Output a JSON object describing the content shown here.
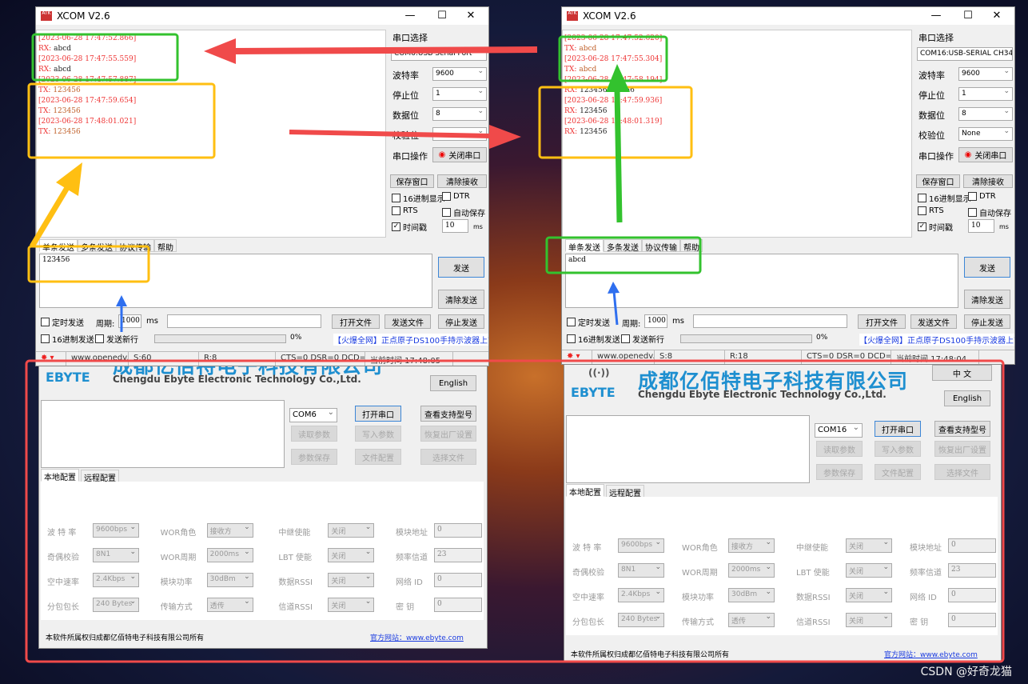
{
  "xcom": [
    {
      "title": "XCOM V2.6",
      "log": [
        {
          "kind": "ts",
          "text": "[2023-06-28 17:47:52.866]"
        },
        {
          "kind": "rx",
          "label": "RX:",
          "text": "abcd"
        },
        {
          "kind": "ts",
          "text": "[2023-06-28 17:47:55.559]"
        },
        {
          "kind": "rx",
          "label": "RX:",
          "text": "abcd"
        },
        {
          "kind": "ts",
          "text": "[2023-06-28 17:47:57.887]"
        },
        {
          "kind": "tx",
          "label": "TX:",
          "text": "123456"
        },
        {
          "kind": "ts",
          "text": "[2023-06-28 17:47:59.654]"
        },
        {
          "kind": "tx",
          "label": "TX:",
          "text": "123456"
        },
        {
          "kind": "ts",
          "text": "[2023-06-28 17:48:01.021]"
        },
        {
          "kind": "tx",
          "label": "TX:",
          "text": "123456"
        }
      ],
      "port_label": "串口选择",
      "port": "COM6:USB Serial Port",
      "baud_label": "波特率",
      "baud": "9600",
      "stop_label": "停止位",
      "stop": "1",
      "data_label": "数据位",
      "databits": "8",
      "parity_label": "校验位",
      "parity": "",
      "op_label": "串口操作",
      "close_port": "关闭串口",
      "save_window": "保存窗口",
      "clear_recv": "清除接收",
      "hex_display": "16进制显示",
      "dtr": "DTR",
      "rts": "RTS",
      "auto_save": "自动保存",
      "timestamp": "时间戳",
      "timestamp_checked": true,
      "interval": "10",
      "ms": "ms",
      "tabs": [
        "单条发送",
        "多条发送",
        "协议传输",
        "帮助"
      ],
      "send_text": "123456",
      "send": "发送",
      "clear_send": "清除发送",
      "timed_send": "定时发送",
      "period_label": "周期:",
      "period": "1000",
      "period_unit": "ms",
      "open_file": "打开文件",
      "send_file": "发送文件",
      "stop_send": "停止发送",
      "hex_send": "16进制发送",
      "send_newline": "发送新行",
      "progress": "0%",
      "ad": "【火爆全网】正点原子DS100手持示波器上市",
      "status": [
        "www.openedv.com",
        "S:60",
        "R:8",
        "CTS=0 DSR=0 DCD=0",
        "当前时间 17:48:05"
      ]
    },
    {
      "title": "XCOM V2.6",
      "log": [
        {
          "kind": "ts",
          "text": "[2023-06-28 17:47:52.620]"
        },
        {
          "kind": "tx",
          "label": "TX:",
          "text": "abcd"
        },
        {
          "kind": "ts",
          "text": "[2023-06-28 17:47:55.304]"
        },
        {
          "kind": "tx",
          "label": "TX:",
          "text": "abcd"
        },
        {
          "kind": "ts",
          "text": "[2023-06-28 17:47:58.194]"
        },
        {
          "kind": "rx",
          "label": "RX:",
          "text": "123456123456"
        },
        {
          "kind": "ts",
          "text": "[2023-06-28 17:47:59.936]"
        },
        {
          "kind": "rx",
          "label": "RX:",
          "text": "123456"
        },
        {
          "kind": "ts",
          "text": "[2023-06-28 17:48:01.319]"
        },
        {
          "kind": "rx",
          "label": "RX:",
          "text": "123456"
        }
      ],
      "port_label": "串口选择",
      "port": "COM16:USB-SERIAL CH34",
      "baud_label": "波特率",
      "baud": "9600",
      "stop_label": "停止位",
      "stop": "1",
      "data_label": "数据位",
      "databits": "8",
      "parity_label": "校验位",
      "parity": "None",
      "op_label": "串口操作",
      "close_port": "关闭串口",
      "save_window": "保存窗口",
      "clear_recv": "清除接收",
      "hex_display": "16进制显示",
      "dtr": "DTR",
      "rts": "RTS",
      "auto_save": "自动保存",
      "timestamp": "时间戳",
      "timestamp_checked": true,
      "interval": "10",
      "ms": "ms",
      "tabs": [
        "单条发送",
        "多条发送",
        "协议传输",
        "帮助"
      ],
      "send_text": "abcd",
      "send": "发送",
      "clear_send": "清除发送",
      "timed_send": "定时发送",
      "period_label": "周期:",
      "period": "1000",
      "period_unit": "ms",
      "open_file": "打开文件",
      "send_file": "发送文件",
      "stop_send": "停止发送",
      "hex_send": "16进制发送",
      "send_newline": "发送新行",
      "progress": "0%",
      "ad": "【火爆全网】正点原子DS100手持示波器上市",
      "status": [
        "www.openedv.com",
        "S:8",
        "R:18",
        "CTS=0 DSR=0 DCD=0",
        "当前时间 17:48:04"
      ]
    }
  ],
  "ebyte": [
    {
      "logo": "EBYTE",
      "company_cn": "成都亿佰特电子科技有限公司",
      "company_en": "Chengdu Ebyte Electronic Technology Co.,Ltd.",
      "lang_zh": "",
      "lang_en": "English",
      "com": "COM6",
      "open_port": "打开串口",
      "models": "查看支持型号",
      "read": "读取参数",
      "write": "写入参数",
      "reset": "恢复出厂设置",
      "save": "参数保存",
      "file_cfg": "文件配置",
      "choose_file": "选择文件",
      "tabs": [
        "本地配置",
        "远程配置"
      ],
      "fields": [
        [
          "波 特 率",
          "9600bps",
          "WOR角色",
          "接收方",
          "中继使能",
          "关闭",
          "模块地址",
          "0"
        ],
        [
          "奇偶校验",
          "8N1",
          "WOR周期",
          "2000ms",
          "LBT 使能",
          "关闭",
          "频率信道",
          "23"
        ],
        [
          "空中速率",
          "2.4Kbps",
          "模块功率",
          "30dBm",
          "数据RSSI",
          "关闭",
          "网络  ID",
          "0"
        ],
        [
          "分包包长",
          "240 Bytes",
          "传输方式",
          "透传",
          "信道RSSI",
          "关闭",
          "密    钥",
          "0"
        ]
      ],
      "copyright": "本软件所属权归成都亿佰特电子科技有限公司所有",
      "website": "官方网站：www.ebyte.com"
    },
    {
      "logo": "EBYTE",
      "company_cn": "成都亿佰特电子科技有限公司",
      "company_en": "Chengdu Ebyte Electronic Technology Co.,Ltd.",
      "lang_zh": "中 文",
      "lang_en": "English",
      "com": "COM16",
      "open_port": "打开串口",
      "models": "查看支持型号",
      "read": "读取参数",
      "write": "写入参数",
      "reset": "恢复出厂设置",
      "save": "参数保存",
      "file_cfg": "文件配置",
      "choose_file": "选择文件",
      "tabs": [
        "本地配置",
        "远程配置"
      ],
      "fields": [
        [
          "波 特 率",
          "9600bps",
          "WOR角色",
          "接收方",
          "中继使能",
          "关闭",
          "模块地址",
          "0"
        ],
        [
          "奇偶校验",
          "8N1",
          "WOR周期",
          "2000ms",
          "LBT 使能",
          "关闭",
          "频率信道",
          "23"
        ],
        [
          "空中速率",
          "2.4Kbps",
          "模块功率",
          "30dBm",
          "数据RSSI",
          "关闭",
          "网络  ID",
          "0"
        ],
        [
          "分包包长",
          "240 Bytes",
          "传输方式",
          "透传",
          "信道RSSI",
          "关闭",
          "密    钥",
          "0"
        ]
      ],
      "copyright": "本软件所属权归成都亿佰特电子科技有限公司所有",
      "website": "官方网站：www.ebyte.com"
    }
  ],
  "annotation_colors": {
    "red": "#f04a4a",
    "green": "#33c22e",
    "yellow": "#ffbf12",
    "blue": "#2f6fef"
  },
  "watermark": "CSDN @好奇龙猫"
}
